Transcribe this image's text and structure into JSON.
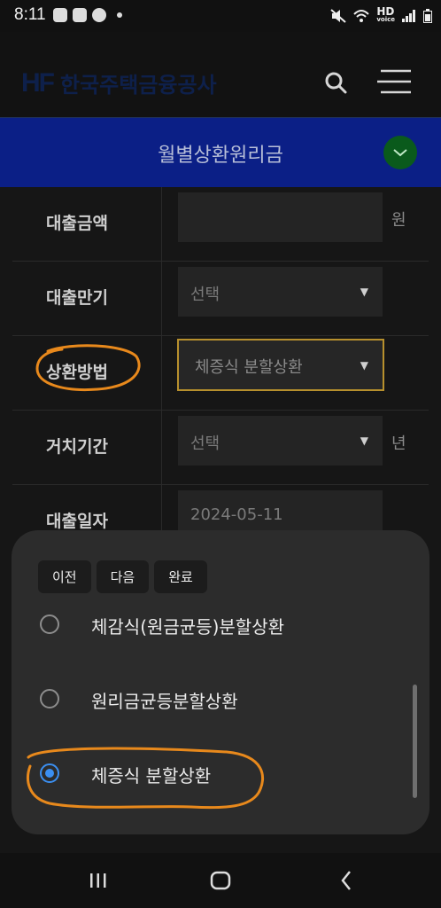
{
  "status": {
    "time": "8:11",
    "net_label": "HD",
    "net_sub": "voice"
  },
  "header": {
    "logo_mark": "HF",
    "logo_text": "한국주택금융공사"
  },
  "page": {
    "title": "월별상환원리금"
  },
  "form": {
    "rows": [
      {
        "label": "대출금액",
        "value": "",
        "unit": "원"
      },
      {
        "label": "대출만기",
        "value": "선택",
        "unit": ""
      },
      {
        "label": "상환방법",
        "value": "체증식 분할상환",
        "unit": ""
      },
      {
        "label": "거치기간",
        "value": "선택",
        "unit": "년"
      },
      {
        "label": "대출일자",
        "value": "2024-05-11",
        "unit": ""
      }
    ]
  },
  "picker": {
    "prev": "이전",
    "next": "다음",
    "done": "완료",
    "options": [
      {
        "label": "체감식(원금균등)분할상환",
        "selected": false
      },
      {
        "label": "원리금균등분할상환",
        "selected": false
      },
      {
        "label": "체증식 분할상환",
        "selected": true
      }
    ]
  },
  "colors": {
    "banner": "#0b1f86",
    "highlight": "#b7902d",
    "annotation": "#e8891c",
    "radio_on": "#3b8ff1"
  }
}
